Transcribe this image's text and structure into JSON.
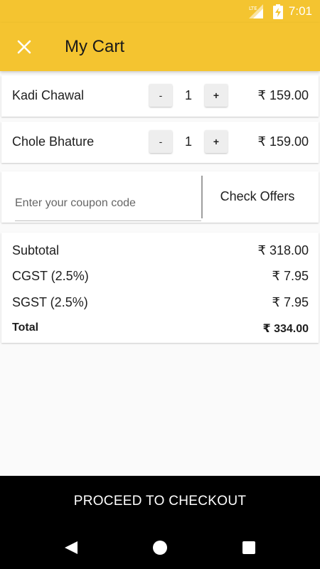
{
  "status_bar": {
    "time": "7:01",
    "network": "LTE"
  },
  "app_bar": {
    "title": "My Cart"
  },
  "cart": {
    "items": [
      {
        "name": "Kadi Chawal",
        "quantity": "1",
        "price": "₹ 159.00",
        "minus_label": "-",
        "plus_label": "+"
      },
      {
        "name": "Chole Bhature",
        "quantity": "1",
        "price": "₹ 159.00",
        "minus_label": "-",
        "plus_label": "+"
      }
    ]
  },
  "coupon": {
    "placeholder": "Enter your coupon code",
    "value": "",
    "check_offers_label": "Check Offers"
  },
  "summary": {
    "subtotal_label": "Subtotal",
    "subtotal_value": "₹ 318.00",
    "cgst_label": "CGST (2.5%)",
    "cgst_value": "₹ 7.95",
    "sgst_label": "SGST (2.5%)",
    "sgst_value": "₹ 7.95",
    "total_label": "Total",
    "total_value": "₹ 334.00"
  },
  "checkout": {
    "label": "PROCEED TO CHECKOUT"
  },
  "icons": {
    "close": "close-icon",
    "back": "back-triangle-icon",
    "home": "home-circle-icon",
    "recent": "recent-apps-square-icon",
    "battery": "battery-charging-icon",
    "signal": "lte-signal-icon"
  },
  "colors": {
    "accent": "#f4c430",
    "checkout_bg": "#000000",
    "nav_bg": "#000000"
  }
}
